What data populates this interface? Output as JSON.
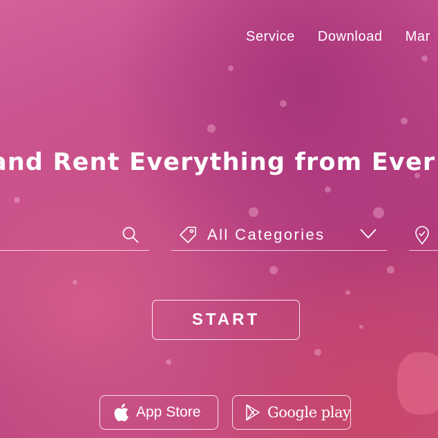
{
  "nav": {
    "items": [
      "Service",
      "Download",
      "Mar"
    ]
  },
  "hero": {
    "headline": "and Rent Everything from Ever"
  },
  "search": {
    "value": "",
    "placeholder": ""
  },
  "category": {
    "selected": "All Categories"
  },
  "cta": {
    "start_label": "START"
  },
  "stores": {
    "apple_label": "App Store",
    "google_label": "Google play"
  },
  "colors": {
    "background_primary": "#c24a8a",
    "background_accent": "#d4619a",
    "text": "#ffffff"
  },
  "icons": {
    "search": "search-icon",
    "category": "tag-icon",
    "dropdown": "chevron-down-icon",
    "location": "location-pin-icon",
    "apple": "apple-icon",
    "google": "google-play-icon"
  }
}
